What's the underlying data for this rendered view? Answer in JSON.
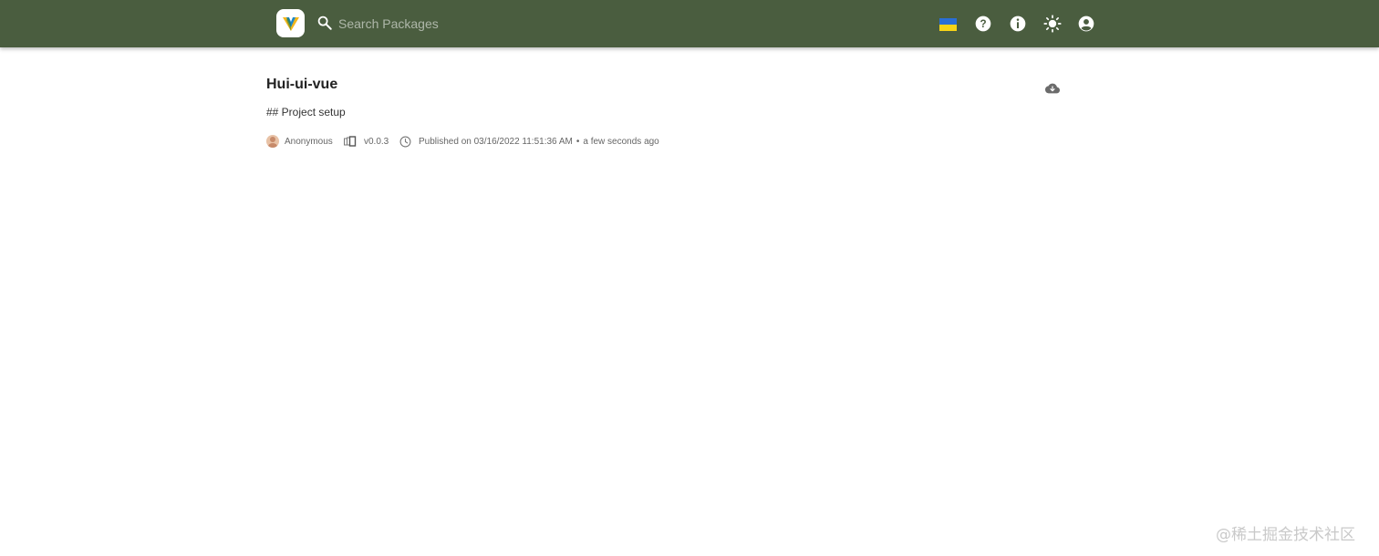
{
  "header": {
    "search": {
      "placeholder": "Search Packages",
      "value": ""
    },
    "icons": [
      "logo-icon",
      "search-icon",
      "flag-icon",
      "help-icon",
      "info-icon",
      "theme-icon",
      "account-icon"
    ],
    "colors": {
      "background": "#4a5d3f",
      "flag_top": "#2a6fd6",
      "flag_bottom": "#f7d417"
    }
  },
  "package": {
    "name": "Hui-ui-vue",
    "description": "## Project setup",
    "author": "Anonymous",
    "version": "v0.0.3",
    "published": "Published on 03/16/2022 11:51:36 AM",
    "separator": "•",
    "relative_time": "a few seconds ago"
  },
  "watermark": "@稀土掘金技术社区"
}
